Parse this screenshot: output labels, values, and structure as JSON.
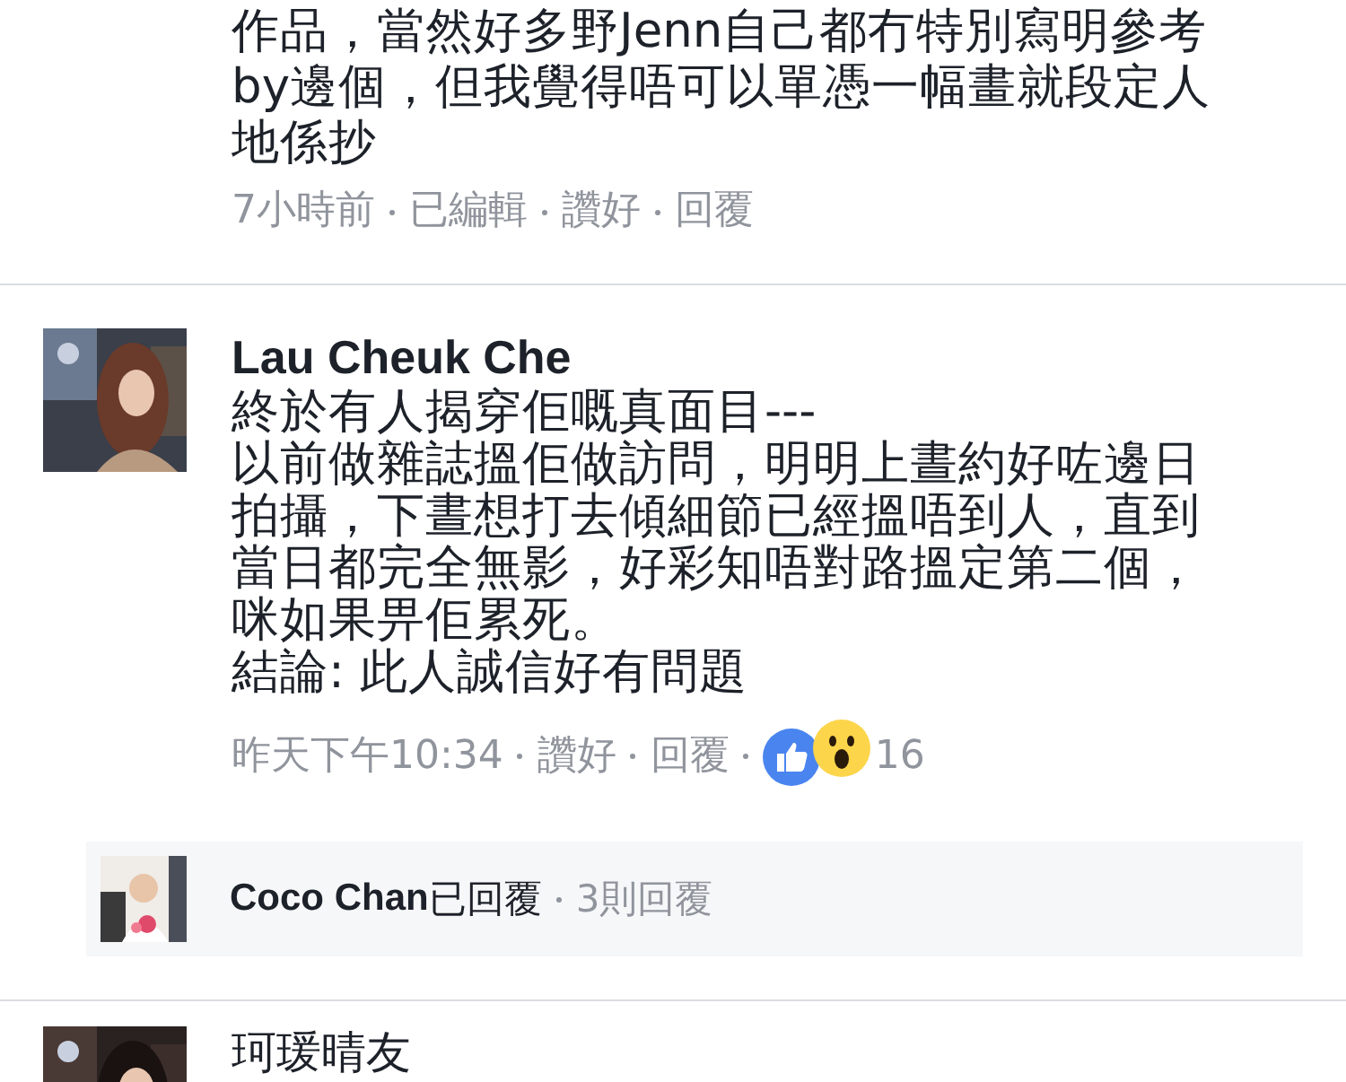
{
  "comments": [
    {
      "kind": "partial",
      "lines": [
        "作品，當然好多野Jenn自己都冇特別寫明參考",
        "by邊個，但我覺得唔可以單憑一幅畫就段定人",
        "地係抄"
      ],
      "meta": [
        "7小時前",
        "已編輯",
        "讚好",
        "回覆"
      ]
    },
    {
      "kind": "full",
      "author": "Lau Cheuk Che",
      "lines": [
        "終於有人揭穿佢嘅真面目---",
        "以前做雜誌搵佢做訪問，明明上晝約好咗邊日",
        "拍攝，下晝想打去傾細節已經搵唔到人，直到",
        "當日都完全無影，好彩知唔對路搵定第二個，",
        "咪如果畀佢累死。",
        "結論: 此人誠信好有問題"
      ],
      "meta": [
        "昨天下午10:34",
        "讚好",
        "回覆"
      ],
      "reactions": {
        "count": "16"
      },
      "reply_summary": {
        "name": "Coco Chan",
        "action": "已回覆",
        "count": "3則回覆"
      }
    },
    {
      "kind": "header",
      "author": "珂瑗晴友"
    }
  ]
}
